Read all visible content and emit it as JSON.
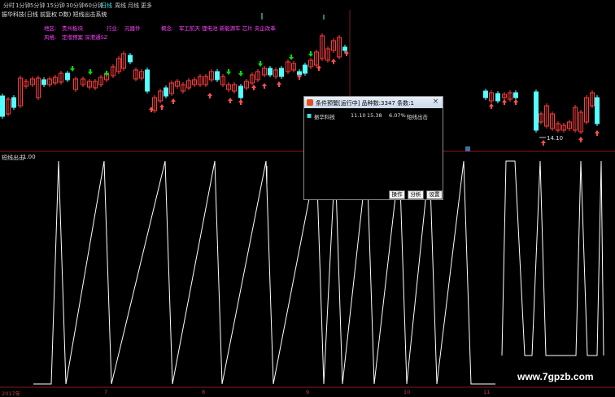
{
  "toolbar": {
    "items": [
      {
        "label": "分时",
        "active": false
      },
      {
        "label": "1分钟",
        "active": false
      },
      {
        "label": "5分钟",
        "active": false
      },
      {
        "label": "15分钟",
        "active": false
      },
      {
        "label": "30分钟",
        "active": false
      },
      {
        "label": "60分钟",
        "active": false
      },
      {
        "label": "日线",
        "active": true
      },
      {
        "label": "周线",
        "active": false
      },
      {
        "label": "月线",
        "active": false
      },
      {
        "label": "更多",
        "active": false
      }
    ]
  },
  "chart_title": "振华科技(日线 前复权 D数) 短线出击系统",
  "stock_info": {
    "region_key": "地区:",
    "region_val": "贵州板块",
    "industry_key": "行业:",
    "industry_val": "元器件",
    "concept_key": "概念:",
    "concept_val": "军工航天 锂电池 新能源车 芯片 央企改革",
    "style_key": "风格:",
    "style_val": "定增预案 深港通SZ"
  },
  "indicator": {
    "label": "短线出击",
    "value": "1.00"
  },
  "price_annotation": "14.10",
  "x_labels": [
    "2017年",
    "7",
    "8",
    "9",
    "10",
    "11"
  ],
  "watermark": "www.7gpzb.com",
  "dialog": {
    "title": "条件预警[运行中] 品种数:3347 条数:1",
    "close_label": "×",
    "row": {
      "marker": "■",
      "name": "振华科技",
      "date": "11.10",
      "time": "15.38",
      "pct": "6.07%",
      "signal": "短线出击"
    },
    "buttons": {
      "op": "操作",
      "analyze": "分析",
      "settings": "设置"
    }
  },
  "colors": {
    "up": "#ff3c3c",
    "down": "#54ffff",
    "signal_line": "#ffffff",
    "arrow_up": "#ff5050",
    "arrow_down": "#00e000"
  },
  "chart_data": {
    "type": "candlestick",
    "x_labels": [
      "2017年",
      "7",
      "8",
      "9",
      "10",
      "11"
    ],
    "indicator": {
      "name": "短线出击",
      "value": "1.00",
      "levels": [
        0,
        1
      ]
    },
    "price_note": "14.10"
  }
}
